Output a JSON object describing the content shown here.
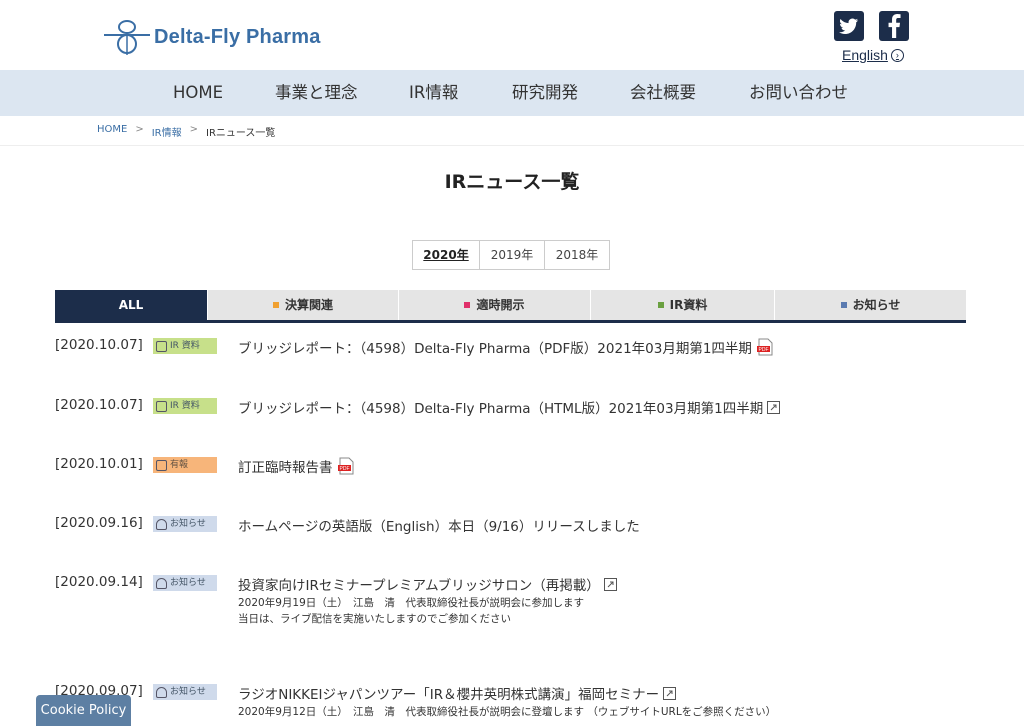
{
  "brand": {
    "name": "Delta-Fly Pharma"
  },
  "social": {
    "twitter": "twitter-icon",
    "facebook": "facebook-icon",
    "english_label": "English"
  },
  "nav": [
    "HOME",
    "事業と理念",
    "IR情報",
    "研究開発",
    "会社概要",
    "お問い合わせ"
  ],
  "breadcrumb": {
    "home": "HOME",
    "sep": ">",
    "ir": "IR情報",
    "current": "IRニュース一覧"
  },
  "page_title": "IRニュース一覧",
  "years": [
    "2020年",
    "2019年",
    "2018年"
  ],
  "categories": [
    {
      "label": "ALL",
      "color": ""
    },
    {
      "label": "決算関連",
      "color": "#f0a030"
    },
    {
      "label": "適時開示",
      "color": "#e0306a"
    },
    {
      "label": "IR資料",
      "color": "#6aa040"
    },
    {
      "label": "お知らせ",
      "color": "#5a7ab0"
    }
  ],
  "news": [
    {
      "date": "[2020.10.07]",
      "badge": "IR 資料",
      "badge_type": "ir",
      "title": "ブリッジレポート：（4598）Delta-Fly Pharma（PDF版）2021年03月期第1四半期",
      "icon": "pdf",
      "sub": []
    },
    {
      "date": "[2020.10.07]",
      "badge": "IR 資料",
      "badge_type": "ir",
      "title": "ブリッジレポート：（4598）Delta-Fly Pharma（HTML版）2021年03月期第1四半期",
      "icon": "external",
      "sub": []
    },
    {
      "date": "[2020.10.01]",
      "badge": "有報",
      "badge_type": "yuho",
      "title": "訂正臨時報告書",
      "icon": "pdf",
      "sub": []
    },
    {
      "date": "[2020.09.16]",
      "badge": "お知らせ",
      "badge_type": "info",
      "title": "ホームページの英語版（English）本日（9/16）リリースしました",
      "icon": "",
      "sub": []
    },
    {
      "date": "[2020.09.14]",
      "badge": "お知らせ",
      "badge_type": "info",
      "title": "投資家向けIRセミナープレミアムブリッジサロン（再掲載）",
      "icon": "external",
      "sub": [
        "2020年9月19日（土）　江島　清　代表取締役社長が説明会に参加します",
        "当日は、ライブ配信を実施いたしますのでご参加ください"
      ]
    },
    {
      "date": "[2020.09.07]",
      "badge": "お知らせ",
      "badge_type": "info",
      "title": "ラジオNIKKEIジャパンツアー「IR＆櫻井英明株式講演」福岡セミナー",
      "icon": "external",
      "sub": [
        "2020年9月12日（土）　江島　清　代表取締役社長が説明会に登壇します （ウェブサイトURLをご参照ください）"
      ]
    }
  ],
  "cookie": "Cookie Policy",
  "colors": {
    "navy": "#1c2d4a",
    "nav_bg": "#dce6f1",
    "brand_blue": "#3a6ea5"
  }
}
